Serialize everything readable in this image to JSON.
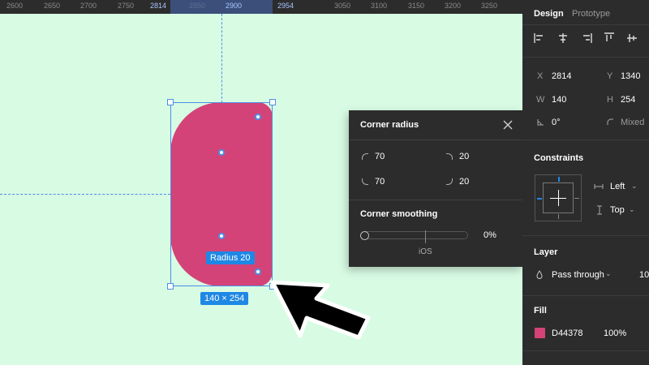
{
  "ruler": {
    "ticks": [
      "2600",
      "2650",
      "2700",
      "2750",
      "2814",
      "2850",
      "2900",
      "2954",
      "3050",
      "3100",
      "3150",
      "3200",
      "3250"
    ]
  },
  "canvas": {
    "background": "#d8fbe4",
    "shape_color": "#d44378",
    "selection_color": "#4a8fe8",
    "radius_tag": "Radius 20",
    "size_tag": "140 × 254"
  },
  "popover": {
    "title": "Corner radius",
    "radii": {
      "top_left": "70",
      "top_right": "20",
      "bottom_left": "70",
      "bottom_right": "20"
    },
    "smoothing_title": "Corner smoothing",
    "smoothing_value": "0%",
    "smoothing_fraction": 0,
    "ios_label": "iOS"
  },
  "panel": {
    "tabs": {
      "design": "Design",
      "prototype": "Prototype"
    },
    "x_label": "X",
    "x_value": "2814",
    "y_label": "Y",
    "y_value": "1340",
    "w_label": "W",
    "w_value": "140",
    "h_label": "H",
    "h_value": "254",
    "rotation": "0°",
    "corner": "Mixed",
    "constraints_title": "Constraints",
    "constraint_h": "Left",
    "constraint_v": "Top",
    "layer_title": "Layer",
    "blend_mode": "Pass through",
    "layer_opacity": "10",
    "fill_title": "Fill",
    "fill_hex": "D44378",
    "fill_opacity": "100%"
  }
}
